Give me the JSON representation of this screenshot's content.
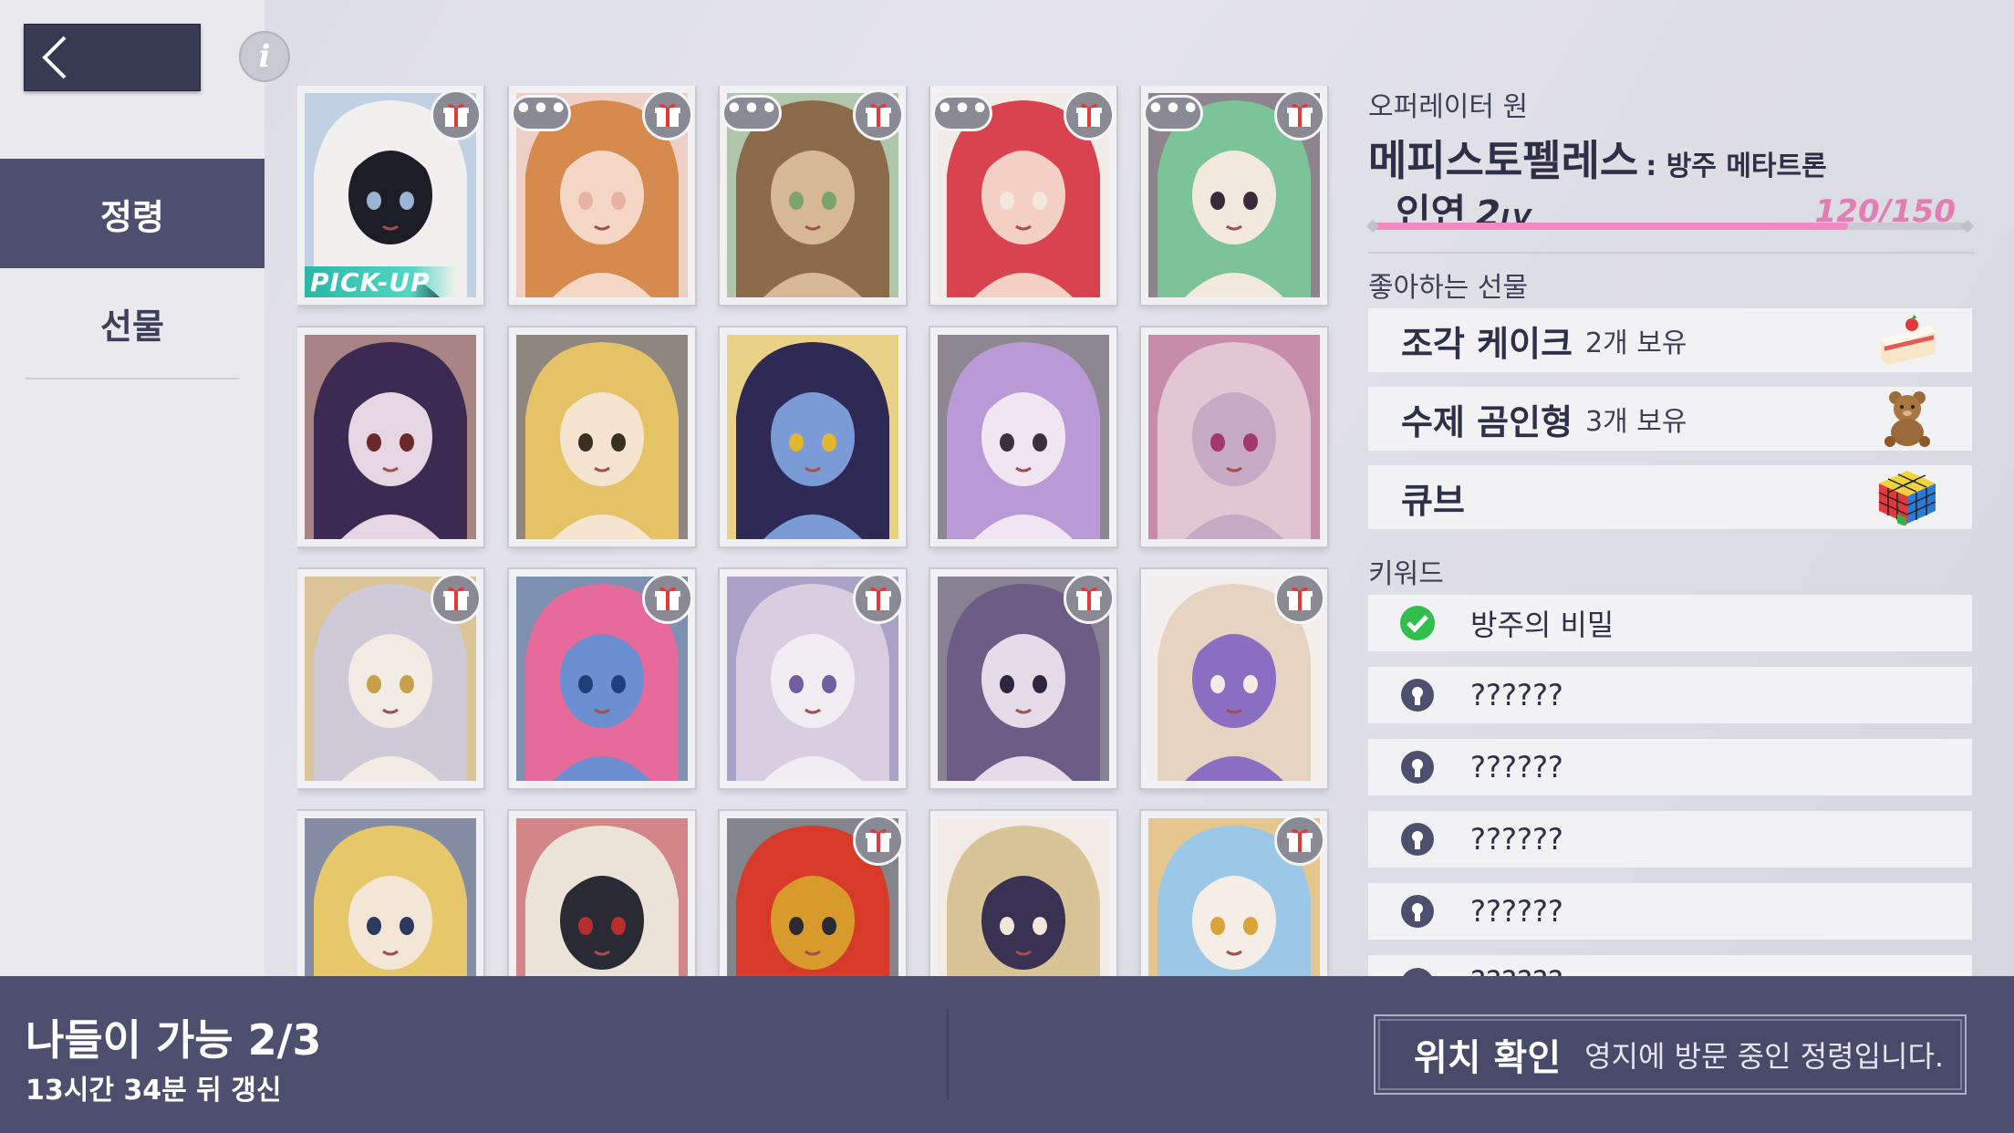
{
  "nav": {
    "back_label": "",
    "info_label": "i",
    "menu": [
      {
        "label": "정령",
        "active": true
      },
      {
        "label": "선물",
        "active": false
      }
    ]
  },
  "cards": [
    {
      "gift": true,
      "chat": false,
      "pickup": "PICK-UP",
      "colors": [
        "#f2f0ee",
        "#1d1d28",
        "#9bb4d6"
      ]
    },
    {
      "gift": true,
      "chat": true,
      "colors": [
        "#d78a4d",
        "#f4d7c5",
        "#e9b3a1"
      ]
    },
    {
      "gift": true,
      "chat": true,
      "colors": [
        "#8c6a4c",
        "#d7b896",
        "#7aa36d"
      ]
    },
    {
      "gift": true,
      "chat": true,
      "colors": [
        "#d9434f",
        "#f4cfc4",
        "#f1e8de"
      ]
    },
    {
      "gift": true,
      "chat": true,
      "colors": [
        "#7cc39a",
        "#f2e8de",
        "#3a2a3a"
      ]
    },
    {
      "gift": false,
      "chat": false,
      "colors": [
        "#3d2a52",
        "#e6d6e1",
        "#6b2a2a"
      ]
    },
    {
      "gift": false,
      "chat": false,
      "colors": [
        "#e6c267",
        "#f4e4d0",
        "#3a3020"
      ]
    },
    {
      "gift": false,
      "chat": false,
      "colors": [
        "#2f2a55",
        "#7b9bd6",
        "#e2b72e"
      ]
    },
    {
      "gift": false,
      "chat": false,
      "colors": [
        "#b99ad6",
        "#efe6f1",
        "#3a3040"
      ]
    },
    {
      "gift": false,
      "chat": false,
      "colors": [
        "#e2c7d3",
        "#c6a9c4",
        "#a2386e"
      ]
    },
    {
      "gift": true,
      "chat": false,
      "colors": [
        "#cfcad8",
        "#f1ece4",
        "#c9a04a"
      ]
    },
    {
      "gift": true,
      "chat": false,
      "colors": [
        "#e66a9a",
        "#6b8fd0",
        "#1f3f7a"
      ]
    },
    {
      "gift": true,
      "chat": false,
      "colors": [
        "#d7cfe0",
        "#f1edf3",
        "#6f5fa0"
      ]
    },
    {
      "gift": true,
      "chat": false,
      "colors": [
        "#6a5e86",
        "#e4dce9",
        "#2d2640"
      ]
    },
    {
      "gift": true,
      "chat": false,
      "colors": [
        "#e6d3c2",
        "#8a6ec1",
        "#f3ece6"
      ]
    },
    {
      "gift": false,
      "chat": false,
      "colors": [
        "#e6c86a",
        "#f4e6d6",
        "#2a3a60"
      ]
    },
    {
      "gift": false,
      "chat": false,
      "colors": [
        "#ece3d8",
        "#2a2a34",
        "#b82d2d"
      ]
    },
    {
      "gift": true,
      "chat": false,
      "colors": [
        "#d83a2a",
        "#d89a2a",
        "#2a2a34"
      ]
    },
    {
      "gift": false,
      "chat": false,
      "colors": [
        "#d9c497",
        "#3a3252",
        "#f2e6da"
      ]
    },
    {
      "gift": true,
      "chat": false,
      "colors": [
        "#9cc8e8",
        "#f4eee6",
        "#d9a33a"
      ]
    }
  ],
  "detail": {
    "operator": "오퍼레이터 원",
    "name": "메피스토펠레스",
    "subtitle": ": 방주 메타트론",
    "affinity_label": "인연",
    "affinity_level": "2",
    "affinity_level_unit": "LV",
    "affinity_current": 120,
    "affinity_max": 150,
    "affinity_text": "120/150",
    "favorite_gifts_label": "좋아하는 선물",
    "gifts": [
      {
        "name": "조각 케이크",
        "count": "2개 보유",
        "icon": "cake-icon"
      },
      {
        "name": "수제 곰인형",
        "count": "3개 보유",
        "icon": "teddy-bear-icon"
      },
      {
        "name": "큐브",
        "count": "",
        "icon": "rubik-cube-icon"
      }
    ],
    "keyword_label": "키워드",
    "keywords": [
      {
        "text": "방주의 비밀",
        "unlocked": true
      },
      {
        "text": "??????",
        "unlocked": false
      },
      {
        "text": "??????",
        "unlocked": false
      },
      {
        "text": "??????",
        "unlocked": false
      },
      {
        "text": "??????",
        "unlocked": false
      },
      {
        "text": "??????",
        "unlocked": false
      }
    ]
  },
  "bottom": {
    "outing_title": "나들이 가능 2/3",
    "outing_sub": "13시간 34분 뒤 갱신",
    "locate_label": "위치 확인",
    "locate_desc": "영지에 방문 중인 정령입니다."
  },
  "colors": {
    "panel_dark": "#4c4f6d",
    "affinity_pink": "#f08ac0",
    "pickup_teal": "#3cc4b2",
    "check_green": "#2fbf4a"
  }
}
